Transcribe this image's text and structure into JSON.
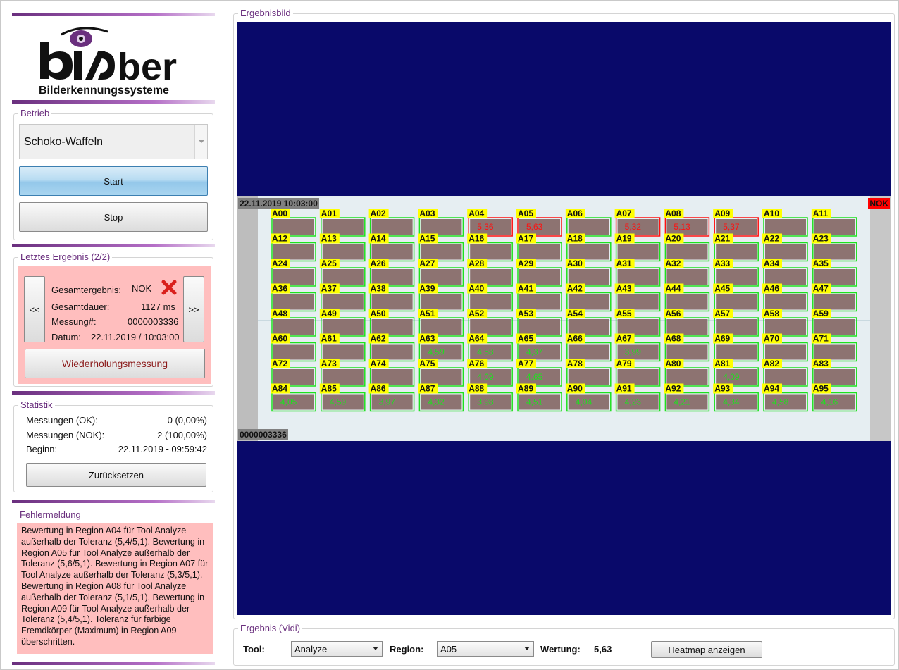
{
  "brand": {
    "name": "bi ber",
    "tagline": "Bilderkennungssysteme",
    "accent": "#6a2f7e"
  },
  "betrieb": {
    "legend": "Betrieb",
    "selected_product": "Schoko-Waffeln",
    "start_label": "Start",
    "stop_label": "Stop"
  },
  "letztes": {
    "legend": "Letztes Ergebnis (2/2)",
    "prev_label": "<<",
    "next_label": ">>",
    "gesamtergebnis_label": "Gesamtergebnis:",
    "gesamtergebnis_value": "NOK",
    "gesamtdauer_label": "Gesamtdauer:",
    "gesamtdauer_value": "1127 ms",
    "messung_label": "Messung#:",
    "messung_value": "0000003336",
    "datum_label": "Datum:",
    "datum_value": "22.11.2019 / 10:03:00",
    "repeat_label": "Wiederholungsmessung",
    "bg_color": "#ffbebe"
  },
  "statistik": {
    "legend": "Statistik",
    "ok_label": "Messungen (OK):",
    "ok_value": "0 (0,00%)",
    "nok_label": "Messungen (NOK):",
    "nok_value": "2 (100,00%)",
    "beginn_label": "Beginn:",
    "beginn_value": "22.11.2019 - 09:59:42",
    "reset_label": "Zurücksetzen"
  },
  "fehler": {
    "legend": "Fehlermeldung",
    "text": "Bewertung in Region A04 für Tool Analyze außerhalb der Toleranz (5,4/5,1). Bewertung in Region A05 für Tool Analyze außerhalb der Toleranz (5,6/5,1). Bewertung in Region A07 für Tool Analyze außerhalb der Toleranz (5,3/5,1). Bewertung in Region A08 für Tool Analyze außerhalb der Toleranz (5,1/5,1). Bewertung in Region A09 für Tool Analyze außerhalb der Toleranz (5,4/5,1). Toleranz für farbige Fremdkörper (Maximum) in Region A09 überschritten."
  },
  "ergebnisbild": {
    "legend": "Ergebnisbild",
    "timestamp": "22.11.2019 10:03:00",
    "status": "NOK",
    "measurement_id": "0000003336",
    "bg_color": "#09096a",
    "regions": [
      {
        "id": "A00",
        "score": "",
        "nok": false
      },
      {
        "id": "A01",
        "score": "",
        "nok": false
      },
      {
        "id": "A02",
        "score": "",
        "nok": false
      },
      {
        "id": "A03",
        "score": "",
        "nok": false
      },
      {
        "id": "A04",
        "score": "5,36",
        "nok": true
      },
      {
        "id": "A05",
        "score": "5,63",
        "nok": true
      },
      {
        "id": "A06",
        "score": "",
        "nok": false
      },
      {
        "id": "A07",
        "score": "5,32",
        "nok": true
      },
      {
        "id": "A08",
        "score": "5,13",
        "nok": true
      },
      {
        "id": "A09",
        "score": "5,37",
        "nok": true
      },
      {
        "id": "A10",
        "score": "",
        "nok": false
      },
      {
        "id": "A11",
        "score": "",
        "nok": false
      },
      {
        "id": "A12",
        "score": "",
        "nok": false
      },
      {
        "id": "A13",
        "score": "",
        "nok": false
      },
      {
        "id": "A14",
        "score": "",
        "nok": false
      },
      {
        "id": "A15",
        "score": "",
        "nok": false
      },
      {
        "id": "A16",
        "score": "",
        "nok": false
      },
      {
        "id": "A17",
        "score": "",
        "nok": false
      },
      {
        "id": "A18",
        "score": "",
        "nok": false
      },
      {
        "id": "A19",
        "score": "",
        "nok": false
      },
      {
        "id": "A20",
        "score": "",
        "nok": false
      },
      {
        "id": "A21",
        "score": "",
        "nok": false
      },
      {
        "id": "A22",
        "score": "",
        "nok": false
      },
      {
        "id": "A23",
        "score": "",
        "nok": false
      },
      {
        "id": "A24",
        "score": "",
        "nok": false
      },
      {
        "id": "A25",
        "score": "",
        "nok": false
      },
      {
        "id": "A26",
        "score": "",
        "nok": false
      },
      {
        "id": "A27",
        "score": "",
        "nok": false
      },
      {
        "id": "A28",
        "score": "",
        "nok": false
      },
      {
        "id": "A29",
        "score": "",
        "nok": false
      },
      {
        "id": "A30",
        "score": "",
        "nok": false
      },
      {
        "id": "A31",
        "score": "",
        "nok": false
      },
      {
        "id": "A32",
        "score": "",
        "nok": false
      },
      {
        "id": "A33",
        "score": "",
        "nok": false
      },
      {
        "id": "A34",
        "score": "",
        "nok": false
      },
      {
        "id": "A35",
        "score": "",
        "nok": false
      },
      {
        "id": "A36",
        "score": "",
        "nok": false
      },
      {
        "id": "A37",
        "score": "",
        "nok": false
      },
      {
        "id": "A38",
        "score": "",
        "nok": false
      },
      {
        "id": "A39",
        "score": "",
        "nok": false
      },
      {
        "id": "A40",
        "score": "",
        "nok": false
      },
      {
        "id": "A41",
        "score": "",
        "nok": false
      },
      {
        "id": "A42",
        "score": "",
        "nok": false
      },
      {
        "id": "A43",
        "score": "",
        "nok": false
      },
      {
        "id": "A44",
        "score": "",
        "nok": false
      },
      {
        "id": "A45",
        "score": "",
        "nok": false
      },
      {
        "id": "A46",
        "score": "",
        "nok": false
      },
      {
        "id": "A47",
        "score": "",
        "nok": false
      },
      {
        "id": "A48",
        "score": "",
        "nok": false
      },
      {
        "id": "A49",
        "score": "",
        "nok": false
      },
      {
        "id": "A50",
        "score": "",
        "nok": false
      },
      {
        "id": "A51",
        "score": "",
        "nok": false
      },
      {
        "id": "A52",
        "score": "",
        "nok": false
      },
      {
        "id": "A53",
        "score": "",
        "nok": false
      },
      {
        "id": "A54",
        "score": "",
        "nok": false
      },
      {
        "id": "A55",
        "score": "",
        "nok": false
      },
      {
        "id": "A56",
        "score": "",
        "nok": false
      },
      {
        "id": "A57",
        "score": "",
        "nok": false
      },
      {
        "id": "A58",
        "score": "",
        "nok": false
      },
      {
        "id": "A59",
        "score": "",
        "nok": false
      },
      {
        "id": "A60",
        "score": "",
        "nok": false
      },
      {
        "id": "A61",
        "score": "",
        "nok": false
      },
      {
        "id": "A62",
        "score": "",
        "nok": false
      },
      {
        "id": "A63",
        "score": "4,59",
        "nok": false
      },
      {
        "id": "A64",
        "score": "4,58",
        "nok": false
      },
      {
        "id": "A65",
        "score": "4,37",
        "nok": false
      },
      {
        "id": "A66",
        "score": "",
        "nok": false
      },
      {
        "id": "A67",
        "score": "3,99",
        "nok": false
      },
      {
        "id": "A68",
        "score": "",
        "nok": false
      },
      {
        "id": "A69",
        "score": "",
        "nok": false
      },
      {
        "id": "A70",
        "score": "",
        "nok": false
      },
      {
        "id": "A71",
        "score": "",
        "nok": false
      },
      {
        "id": "A72",
        "score": "",
        "nok": false
      },
      {
        "id": "A73",
        "score": "",
        "nok": false
      },
      {
        "id": "A74",
        "score": "",
        "nok": false
      },
      {
        "id": "A75",
        "score": "",
        "nok": false
      },
      {
        "id": "A76",
        "score": "4,09",
        "nok": false
      },
      {
        "id": "A77",
        "score": "4,65",
        "nok": false
      },
      {
        "id": "A78",
        "score": "",
        "nok": false
      },
      {
        "id": "A79",
        "score": "",
        "nok": false
      },
      {
        "id": "A80",
        "score": "",
        "nok": false
      },
      {
        "id": "A81",
        "score": "4,09",
        "nok": false
      },
      {
        "id": "A82",
        "score": "",
        "nok": false
      },
      {
        "id": "A83",
        "score": "",
        "nok": false
      },
      {
        "id": "A84",
        "score": "4,05",
        "nok": false
      },
      {
        "id": "A85",
        "score": "4,59",
        "nok": false
      },
      {
        "id": "A86",
        "score": "3,97",
        "nok": false
      },
      {
        "id": "A87",
        "score": "4,32",
        "nok": false
      },
      {
        "id": "A88",
        "score": "3,98",
        "nok": false
      },
      {
        "id": "A89",
        "score": "4,51",
        "nok": false
      },
      {
        "id": "A90",
        "score": "4,04",
        "nok": false
      },
      {
        "id": "A91",
        "score": "4,23",
        "nok": false
      },
      {
        "id": "A92",
        "score": "4,21",
        "nok": false
      },
      {
        "id": "A93",
        "score": "4,34",
        "nok": false
      },
      {
        "id": "A94",
        "score": "4,58",
        "nok": false
      },
      {
        "id": "A95",
        "score": "4,16",
        "nok": false
      }
    ]
  },
  "ergebnis_vidi": {
    "legend": "Ergebnis (Vidi)",
    "tool_label": "Tool:",
    "tool_value": "Analyze",
    "region_label": "Region:",
    "region_value": "A05",
    "wertung_label": "Wertung:",
    "wertung_value": "5,63",
    "heatmap_label": "Heatmap anzeigen"
  }
}
